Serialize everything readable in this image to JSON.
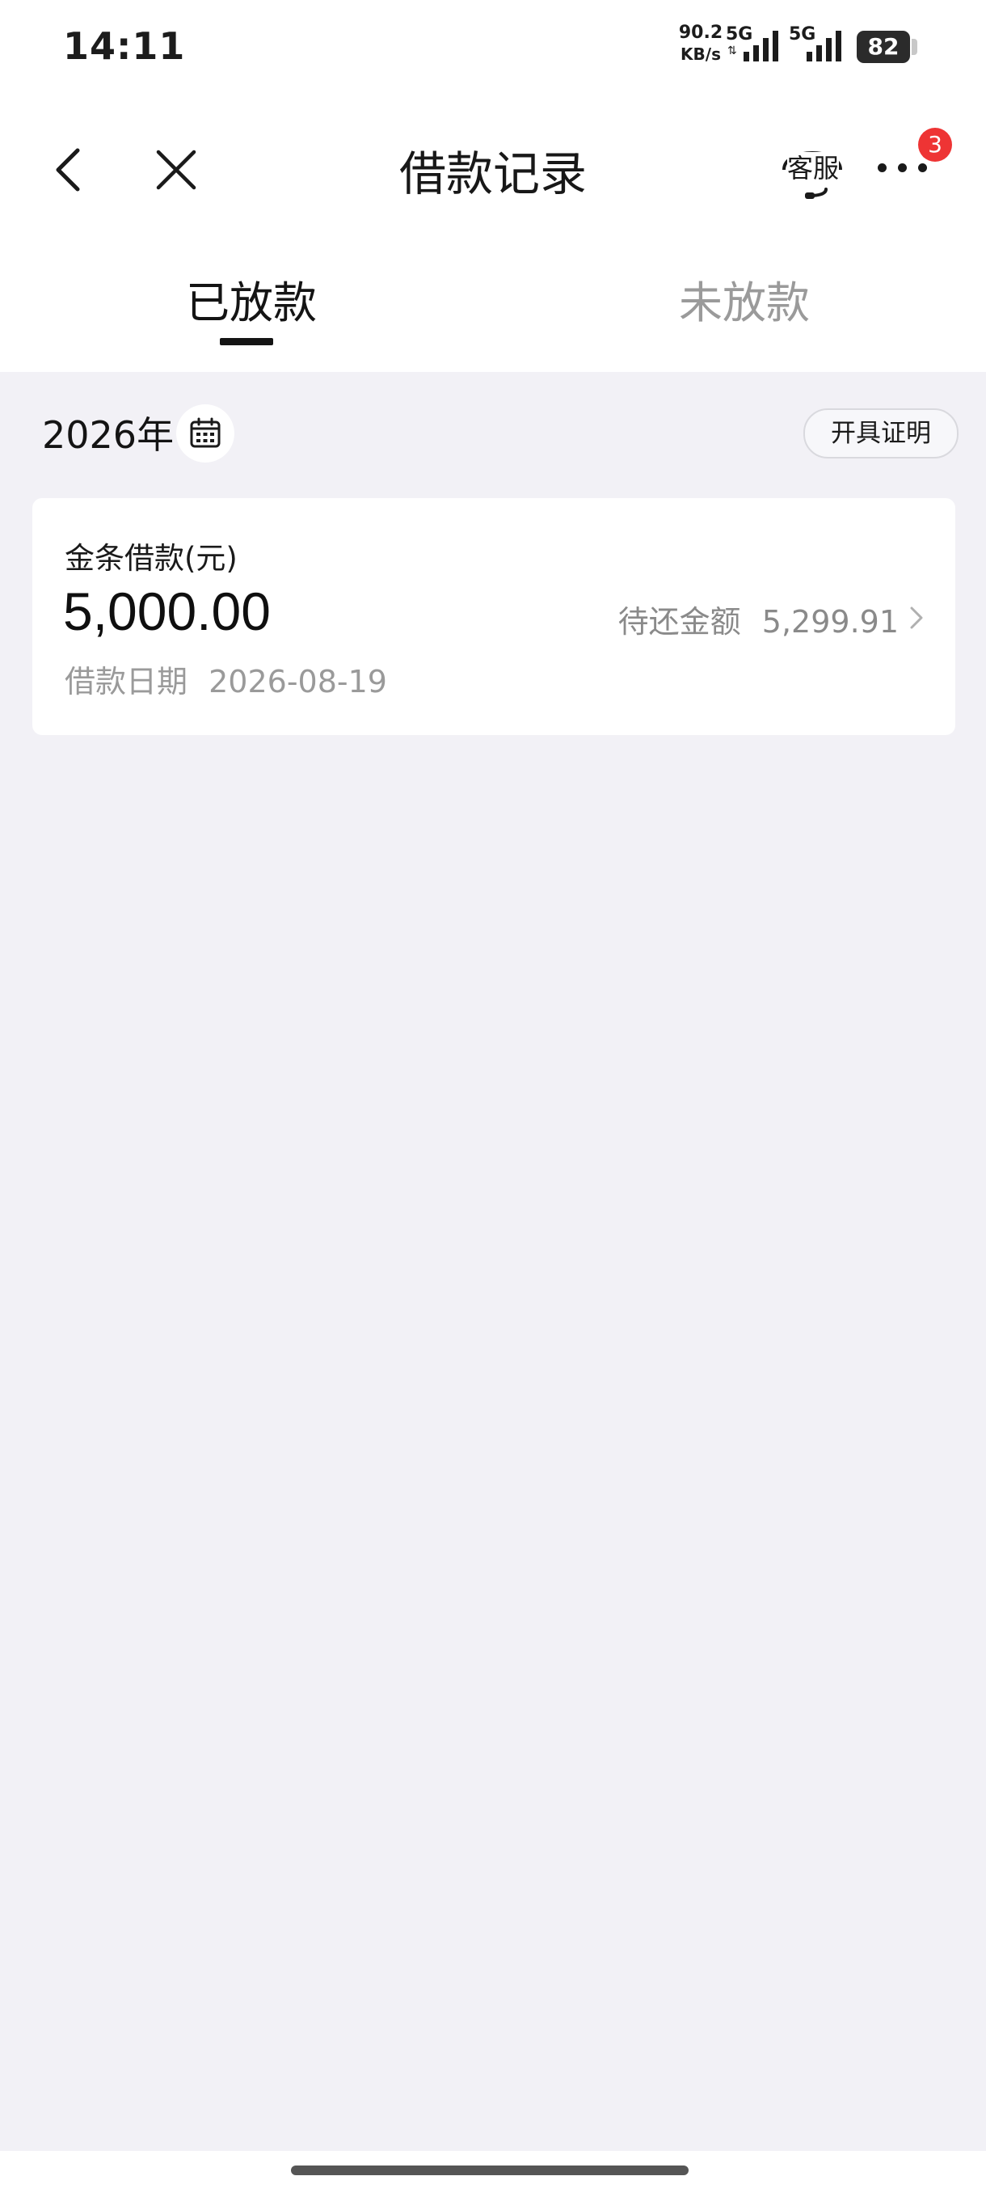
{
  "status_bar": {
    "time": "14:11",
    "net_speed_value": "90.2",
    "net_speed_unit": "KB/s",
    "signal_1_label": "5G",
    "signal_2_label": "5G",
    "battery_level": "82"
  },
  "nav": {
    "title": "借款记录",
    "service_label": "客服",
    "more_badge": "3"
  },
  "tabs": [
    {
      "label": "已放款",
      "active": true
    },
    {
      "label": "未放款",
      "active": false
    }
  ],
  "filter": {
    "year": "2026年",
    "certificate_label": "开具证明"
  },
  "loans": [
    {
      "type": "金条借款(元)",
      "amount": "5,000.00",
      "pending_label": "待还金额",
      "pending_amount": "5,299.91",
      "date_label": "借款日期",
      "date": "2026-08-19"
    }
  ],
  "colors": {
    "background": "#f2f1f6",
    "badge": "#ee3434",
    "active_tab": "#141414",
    "inactive_tab": "#9a9a9a"
  }
}
